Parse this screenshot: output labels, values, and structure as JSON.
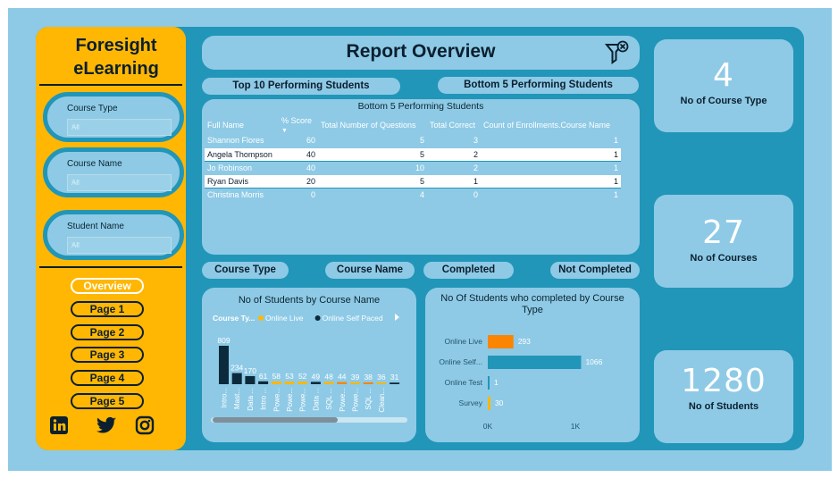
{
  "brand": {
    "line1": "Foresight",
    "line2": "eLearning"
  },
  "report_title": "Report Overview",
  "filter_icon": "filter-clear-icon",
  "slicers": [
    {
      "label": "Course Type",
      "value": "All"
    },
    {
      "label": "Course Name",
      "value": "All"
    },
    {
      "label": "Student Name",
      "value": "All"
    }
  ],
  "nav": [
    "Overview",
    "Page 1",
    "Page 2",
    "Page 3",
    "Page 4",
    "Page 5"
  ],
  "social_icons": [
    "linkedin-icon",
    "twitter-icon",
    "instagram-icon"
  ],
  "top_buttons": [
    "Top 10 Performing Students",
    "Bottom 5 Performing Students"
  ],
  "table": {
    "title": "Bottom 5 Performing Students",
    "columns": [
      "Full Name",
      "% Score",
      "Total Number of Questions",
      "Total Correct",
      "Count of Enrollments.Course Name"
    ],
    "rows": [
      [
        "Shannon Flores",
        "60",
        "5",
        "3",
        "1"
      ],
      [
        "Angela Thompson",
        "40",
        "5",
        "2",
        "1"
      ],
      [
        "Jo Robinson",
        "40",
        "10",
        "2",
        "1"
      ],
      [
        "Ryan Davis",
        "20",
        "5",
        "1",
        "1"
      ],
      [
        "Christina Morris",
        "0",
        "4",
        "0",
        "1"
      ]
    ]
  },
  "mid_buttons": [
    "Course Type",
    "Course Name",
    "Completed",
    "Not Completed"
  ],
  "kpis": [
    {
      "value": "4",
      "label": "No of Course Type"
    },
    {
      "value": "27",
      "label": "No of Courses"
    },
    {
      "value": "1280",
      "label": "No of Students"
    }
  ],
  "colors": {
    "accent": "#ffb703",
    "panel": "#2196b8",
    "card": "#8ecae6",
    "dark": "#0b1f2e",
    "orange": "#fb8500"
  },
  "chart_data": [
    {
      "type": "bar",
      "title": "No of Students by Course Name",
      "legend_title": "Course Ty...",
      "legend": [
        {
          "name": "Online Live",
          "color": "#ffb703"
        },
        {
          "name": "Online Self Paced",
          "color": "#0b2a3c"
        }
      ],
      "categories": [
        "Intro...",
        "Mast...",
        "Data ...",
        "Intro ...",
        "Powe...",
        "Powe...",
        "Powe...",
        "Data ...",
        "SQL ...",
        "Powe...",
        "Powe...",
        "SQL ...",
        "Clean..."
      ],
      "values": [
        809,
        234,
        170,
        61,
        58,
        53,
        52,
        49,
        48,
        44,
        39,
        38,
        36,
        31
      ],
      "series_type": [
        "self",
        "self",
        "self",
        "self",
        "live",
        "live",
        "live",
        "self",
        "live",
        "orange",
        "live",
        "orange",
        "live",
        "self"
      ]
    },
    {
      "type": "bar",
      "orientation": "horizontal",
      "title": "No Of Students who completed by Course Type",
      "categories": [
        "Online Live",
        "Online Self...",
        "Online Test",
        "Survey"
      ],
      "values": [
        293,
        1066,
        1,
        30
      ],
      "bar_colors": [
        "#fb8500",
        "#2196b8",
        "#2196b8",
        "#ffb703"
      ],
      "x_ticks": [
        "0K",
        "1K"
      ],
      "xlim": [
        0,
        1200
      ]
    }
  ]
}
